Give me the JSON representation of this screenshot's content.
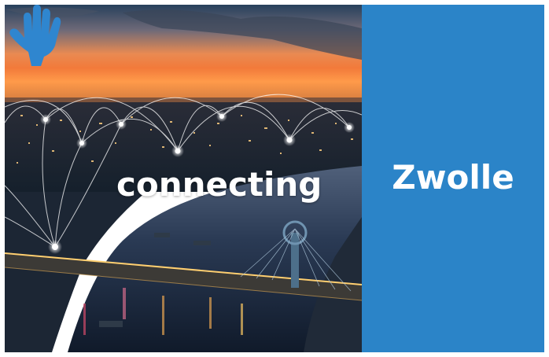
{
  "banner": {
    "tagline": "connecting",
    "city": "Zwolle"
  },
  "colors": {
    "panel_blue": "#2b84c8",
    "hand_blue": "#2f86cf",
    "sky_top": "#1e3550",
    "sky_sunset": "#f0803a",
    "river": "#1a2a40",
    "node_light": "#ffffff"
  },
  "icons": {
    "hand": "hand-icon",
    "network": "network-arcs"
  }
}
